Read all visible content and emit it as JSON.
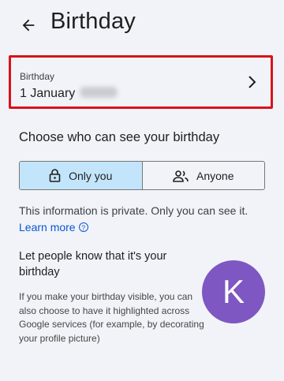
{
  "header": {
    "title": "Birthday"
  },
  "birthday": {
    "label": "Birthday",
    "value": "1 January"
  },
  "visibility": {
    "title": "Choose who can see your birthday",
    "options": [
      {
        "label": "Only you",
        "icon": "lock-icon",
        "selected": true
      },
      {
        "label": "Anyone",
        "icon": "people-icon",
        "selected": false
      }
    ]
  },
  "info": {
    "text": "This information is private. Only you can see it.",
    "learn_more": "Learn more",
    "help_glyph": "?"
  },
  "highlight": {
    "title": "Let people know that it's your birthday",
    "body": "If you make your birthday visible, you can also choose to have it highlighted across Google services (for example, by decorating your profile picture)"
  },
  "avatar": {
    "initial": "K",
    "color": "#7e57c2"
  },
  "colors": {
    "highlight_border": "#d9131b",
    "active_segment": "#c3e5fb",
    "link": "#0b57d0"
  }
}
